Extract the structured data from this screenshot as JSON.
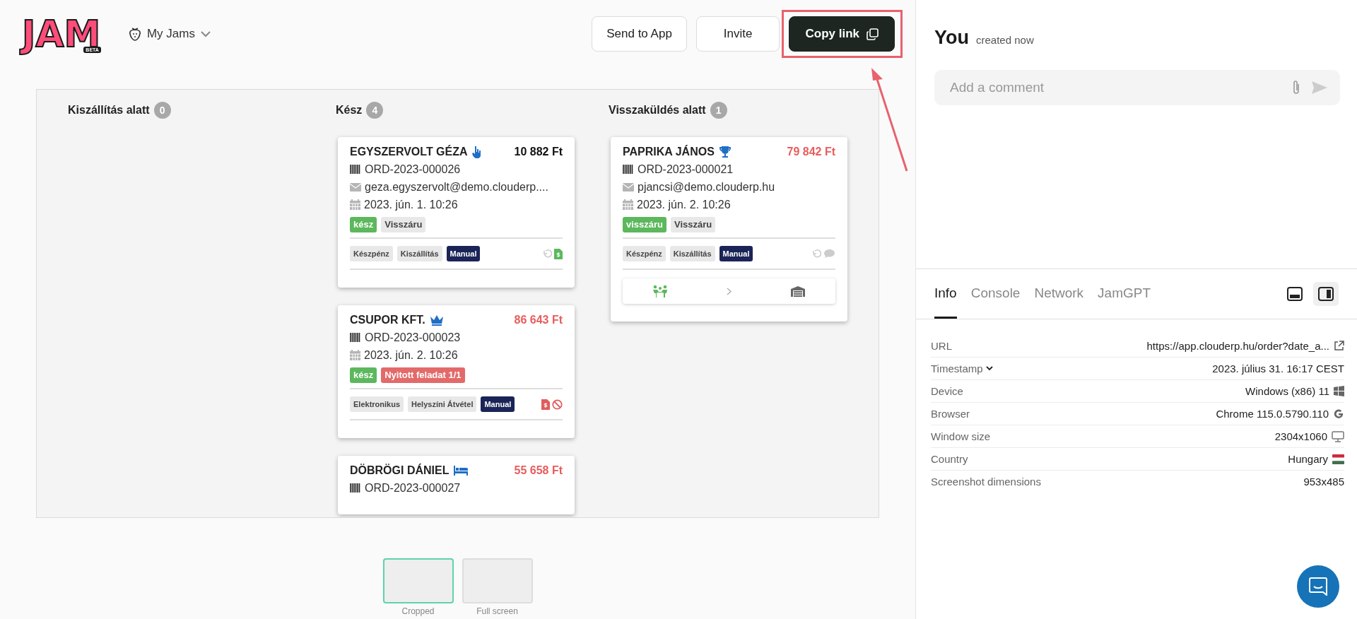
{
  "logo": {
    "text": "JAM",
    "badge": "BETA"
  },
  "workspace": {
    "label": "My Jams"
  },
  "actions": [
    {
      "label": "Send to App",
      "kind": "outline",
      "highlighted": false
    },
    {
      "label": "Invite",
      "kind": "outline",
      "highlighted": false
    },
    {
      "label": "Copy link",
      "kind": "primary",
      "highlighted": true
    }
  ],
  "board": {
    "columns": [
      {
        "title": "Kiszállítás alatt",
        "count": "0"
      },
      {
        "title": "Kész",
        "count": "4",
        "cards": [
          {
            "name": "EGYSZERVOLT GÉZA",
            "kind": "hand",
            "amount": "10 882 Ft",
            "amount_alert": false,
            "order": "ORD-2023-000026",
            "email": "geza.egyszervolt@demo.clouderp....",
            "date": "2023. jún. 1. 10:26",
            "tags": [
              {
                "text": "kész",
                "kind": "status"
              },
              {
                "text": "Visszáru",
                "kind": "plain"
              }
            ],
            "footer_tags": [
              {
                "text": "Készpénz",
                "kind": "plain"
              },
              {
                "text": "Kiszállítás",
                "kind": "plain"
              },
              {
                "text": "Manual",
                "kind": "manual"
              }
            ],
            "footer_icons": [
              {
                "kind": "undo",
                "color": "#cccccc"
              },
              {
                "kind": "invoice",
                "color": "#5cb85c"
              }
            ]
          },
          {
            "name": "CSUPOR KFT.",
            "kind": "crown",
            "amount": "86 643 Ft",
            "amount_alert": true,
            "order": "ORD-2023-000023",
            "date": "2023. jún. 2. 10:26",
            "tags": [
              {
                "text": "kész",
                "kind": "status"
              },
              {
                "text": "Nyitott feladat 1/1",
                "kind": "alert"
              }
            ],
            "footer_tags": [
              {
                "text": "Elektronikus",
                "kind": "plain"
              },
              {
                "text": "Helyszíni Átvétel",
                "kind": "plain"
              },
              {
                "text": "Manual",
                "kind": "manual"
              }
            ],
            "footer_icons": [
              {
                "kind": "invoice",
                "color": "#e05c5c"
              },
              {
                "kind": "ban",
                "color": "#e05c5c"
              }
            ]
          },
          {
            "name": "DÖBRÖGI DÁNIEL",
            "kind": "bed",
            "amount": "55 658 Ft",
            "amount_alert": true,
            "order": "ORD-2023-000027"
          }
        ]
      },
      {
        "title": "Visszaküldés alatt",
        "count": "1",
        "cards": [
          {
            "name": "PAPRIKA JÁNOS",
            "kind": "trophy",
            "amount": "79 842 Ft",
            "amount_alert": true,
            "order": "ORD-2023-000021",
            "email": "pjancsi@demo.clouderp.hu",
            "date": "2023. jún. 2. 10:26",
            "tags": [
              {
                "text": "visszáru",
                "kind": "status"
              },
              {
                "text": "Visszáru",
                "kind": "plain"
              }
            ],
            "footer_tags": [
              {
                "text": "Készpénz",
                "kind": "plain"
              },
              {
                "text": "Kiszállítás",
                "kind": "plain"
              },
              {
                "text": "Manual",
                "kind": "manual"
              }
            ],
            "footer_icons": [
              {
                "kind": "undo",
                "color": "#cccccc"
              },
              {
                "kind": "comment",
                "color": "#cccccc"
              }
            ],
            "steps": [
              {
                "kind": "people",
                "done": true
              },
              {
                "kind": "warehouse",
                "done": false
              }
            ]
          }
        ]
      }
    ]
  },
  "thumbnails": [
    {
      "label": "Cropped",
      "selected": true
    },
    {
      "label": "Full screen",
      "selected": false
    }
  ],
  "author": {
    "name": "You",
    "time": "created now"
  },
  "comment": {
    "placeholder": "Add a comment"
  },
  "tabs": [
    {
      "label": "Info",
      "selected": true
    },
    {
      "label": "Console",
      "selected": false
    },
    {
      "label": "Network",
      "selected": false
    },
    {
      "label": "JamGPT",
      "selected": false
    }
  ],
  "layout_buttons": [
    {
      "kind": "bottom",
      "selected": false
    },
    {
      "kind": "side",
      "selected": true
    }
  ],
  "info": [
    {
      "label": "URL",
      "value": "https://app.clouderp.hu/order?date_a...",
      "kind": "link"
    },
    {
      "label": "Timestamp",
      "value": "2023. július 31. 16:17 CEST",
      "kind": "dropdown"
    },
    {
      "label": "Device",
      "value": "Windows (x86) 11",
      "kind": "device"
    },
    {
      "label": "Browser",
      "value": "Chrome 115.0.5790.110",
      "kind": "browser"
    },
    {
      "label": "Window size",
      "value": "2304x1060",
      "kind": "display"
    },
    {
      "label": "Country",
      "value": "Hungary",
      "kind": "country"
    },
    {
      "label": "Screenshot dimensions",
      "value": "953x485",
      "kind": "plain"
    }
  ]
}
